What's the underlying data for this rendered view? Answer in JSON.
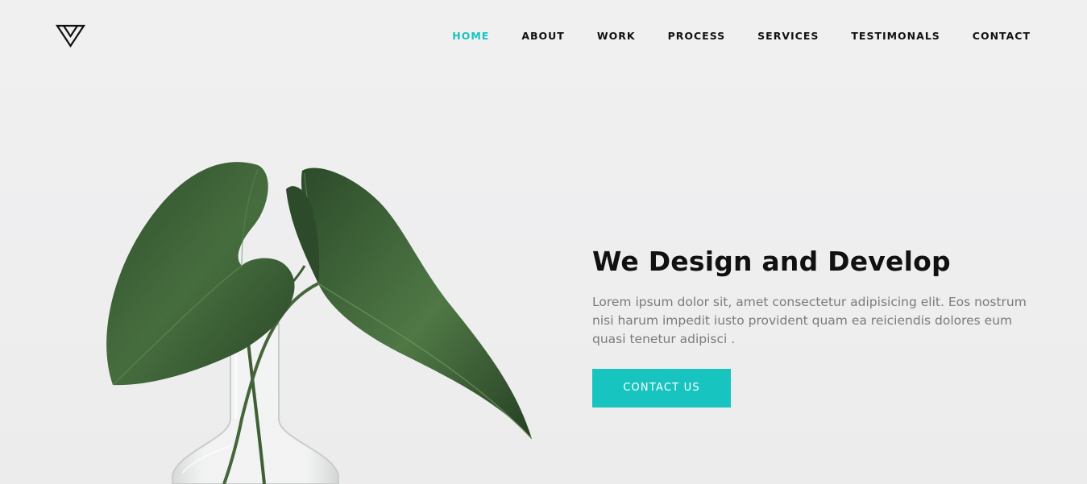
{
  "nav": {
    "items": [
      {
        "label": "HOME",
        "active": true
      },
      {
        "label": "ABOUT",
        "active": false
      },
      {
        "label": "WORK",
        "active": false
      },
      {
        "label": "PROCESS",
        "active": false
      },
      {
        "label": "SERVICES",
        "active": false
      },
      {
        "label": "TESTIMONALS",
        "active": false
      },
      {
        "label": "CONTACT",
        "active": false
      }
    ]
  },
  "hero": {
    "title": "We Design and Develop",
    "description": "Lorem ipsum dolor sit, amet consectetur adipisicing elit. Eos nostrum nisi harum impedit iusto provident quam ea reiciendis dolores eum quasi tenetur adipisci .",
    "cta_label": "CONTACT US"
  },
  "colors": {
    "accent": "#17c4c0",
    "text_dark": "#111111",
    "text_muted": "#7b7b7b",
    "background": "#efefef",
    "leaf": "#3b5e34"
  },
  "icons": {
    "logo": "triangle-logo-icon"
  }
}
